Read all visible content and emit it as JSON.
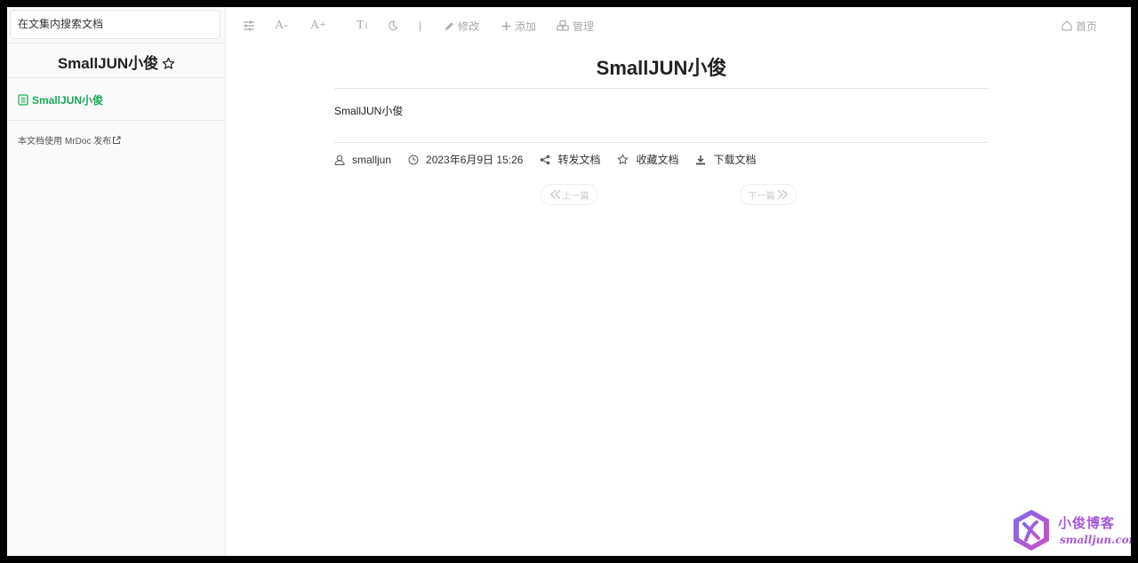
{
  "sidebar": {
    "search_placeholder": "在文集内搜索文档",
    "project_title": "SmallJUN小俊",
    "toc_items": [
      {
        "label": "SmallJUN小俊",
        "active": true
      }
    ],
    "footer_prefix": "本文档使用",
    "footer_link": "MrDoc",
    "footer_suffix": "发布"
  },
  "toolbar": {
    "font_decrease": "A-",
    "font_increase": "A+",
    "font_family": "T",
    "separator": "|",
    "edit_label": "修改",
    "add_label": "添加",
    "manage_label": "管理",
    "home_label": "首页"
  },
  "doc": {
    "title": "SmallJUN小俊",
    "body": "SmallJUN小俊",
    "author": "smalljun",
    "datetime": "2023年6月9日 15:26",
    "share_label": "转发文档",
    "collect_label": "收藏文档",
    "download_label": "下载文档",
    "prev_label": "上一篇",
    "next_label": "下一篇"
  },
  "watermark": {
    "brand_cn": "小俊博客",
    "brand_url": "smalljun.com"
  },
  "colors": {
    "accent_green": "#1aaa55",
    "brand_purple": "#a55bd6",
    "sidebar_bg": "#fafafa"
  }
}
